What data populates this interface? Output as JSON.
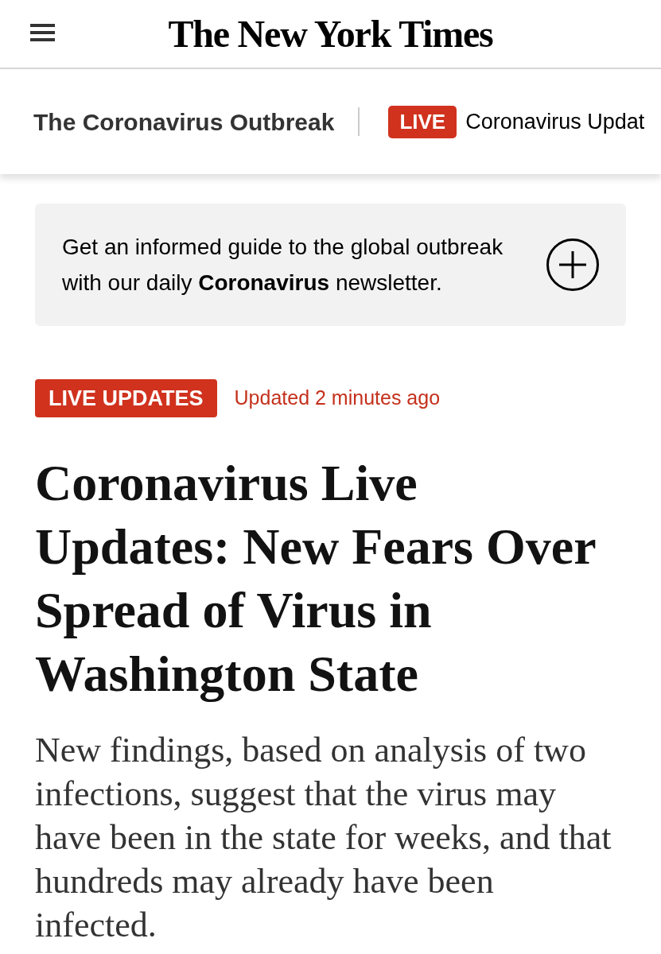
{
  "header": {
    "logo": "The New York Times"
  },
  "section_nav": {
    "section": "The Coronavirus Outbreak",
    "live_badge": "LIVE",
    "live_link": "Coronavirus Updat"
  },
  "newsletter_promo": {
    "text": "Get an informed guide to the global outbreak with our daily **Coronavirus** newsletter."
  },
  "article": {
    "badge": "LIVE UPDATES",
    "timestamp": "Updated 2 minutes ago",
    "headline": "Coronavirus Live Updates: New Fears Over Spread of Virus in Washington State",
    "summary": "New findings, based on analysis of two infections, suggest that the virus may have been in the state for weeks, and that hundreds may already have been infected."
  }
}
